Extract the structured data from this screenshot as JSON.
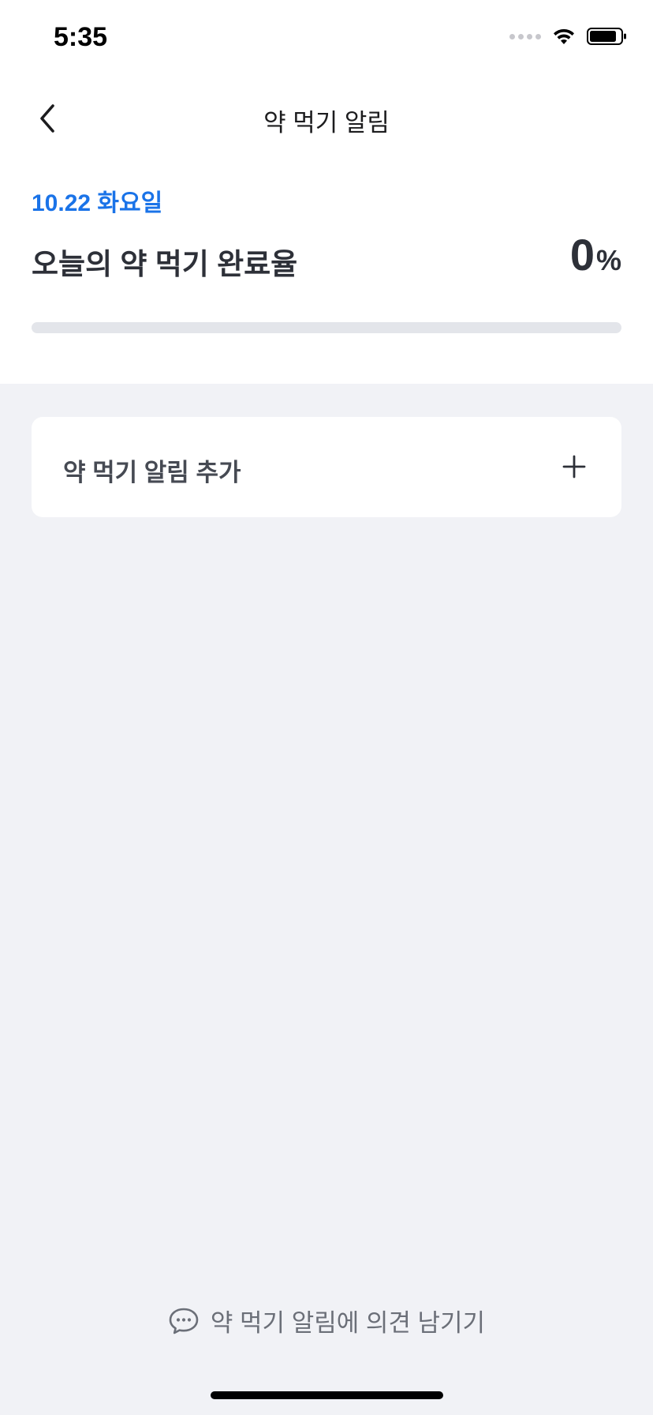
{
  "status_bar": {
    "time": "5:35",
    "icons": [
      "cellular-signal-icon",
      "wifi-icon",
      "battery-icon"
    ]
  },
  "header": {
    "title": "약 먹기 알림",
    "back_icon": "chevron-left-icon"
  },
  "summary": {
    "date": "10.22 화요일",
    "rate_label": "오늘의 약 먹기 완료율",
    "rate_value": "0",
    "rate_unit": "%",
    "progress_fraction": 0
  },
  "add_card": {
    "label": "약 먹기 알림 추가",
    "icon": "plus-icon"
  },
  "feedback": {
    "label": "약 먹기 알림에 의견 남기기",
    "icon": "chat-bubble-icon"
  },
  "colors": {
    "accent": "#1a73e8",
    "background": "#f1f2f6",
    "card": "#ffffff",
    "text_primary": "#2d3038",
    "text_secondary": "#6b6f78",
    "progress_track": "#e3e5ea"
  }
}
